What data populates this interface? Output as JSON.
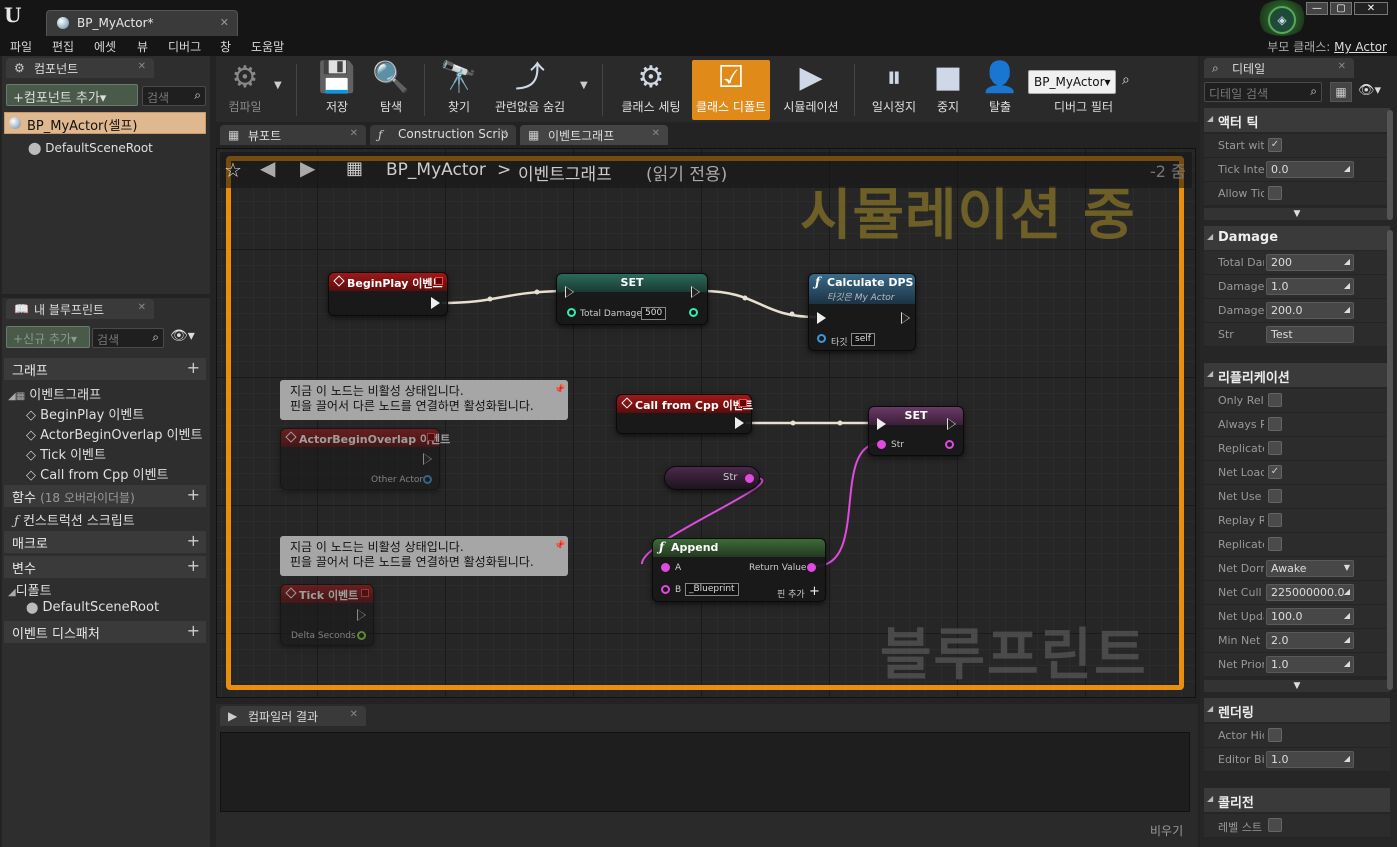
{
  "window": {
    "tab_title": "BP_MyActor*",
    "parent_class_label": "부모 클래스:",
    "parent_class_value": "My Actor"
  },
  "menu": [
    "파일",
    "편집",
    "에셋",
    "뷰",
    "디버그",
    "창",
    "도움말"
  ],
  "components_panel": {
    "tab": "컴포넌트",
    "add_button": "+컴포넌트 추가▾",
    "search_placeholder": "검색",
    "root_item": "BP_MyActor(셀프)",
    "child_item": "DefaultSceneRoot"
  },
  "my_blueprint": {
    "tab": "내 블루프린트",
    "add_new": "+신규 추가▾",
    "search_placeholder": "검색",
    "graphs_label": "그래프",
    "event_graph": "이벤트그래프",
    "events": [
      "BeginPlay 이벤트",
      "ActorBeginOverlap 이벤트",
      "Tick 이벤트",
      "Call from Cpp 이벤트"
    ],
    "functions_label": "함수",
    "functions_sub": "(18 오버라이더블)",
    "construction_script": "컨스트럭션 스크립트",
    "macros_label": "매크로",
    "variables_label": "변수",
    "defaults_label": "디폴트",
    "default_scene_root": "DefaultSceneRoot",
    "dispatchers_label": "이벤트 디스패처"
  },
  "toolbar": {
    "compile": "컴파일",
    "save": "저장",
    "browse": "탐색",
    "find": "찾기",
    "hide_unrelated": "관련없음 숨김",
    "class_settings": "클래스 세팅",
    "class_defaults": "클래스 디폴트",
    "simulation": "시뮬레이션",
    "pause": "일시정지",
    "stop": "중지",
    "eject": "탈출",
    "debug_object": "BP_MyActor▾",
    "debug_filter": "디버그 필터"
  },
  "graph_tabs": [
    "뷰포트",
    "Construction Scrip",
    "이벤트그래프"
  ],
  "graph": {
    "breadcrumb_bp": "BP_MyActor",
    "breadcrumb_sep": ">",
    "breadcrumb_graph": "이벤트그래프",
    "read_only": "(읽기 전용)",
    "zoom": "-2 줌",
    "simulating_watermark": "시뮬레이션 중",
    "blueprint_watermark": "블루프린트",
    "nodes": {
      "beginplay": "BeginPlay 이벤트",
      "set1_title": "SET",
      "set1_pin": "Total Damage",
      "set1_value": "500",
      "calc_title": "Calculate DPS",
      "calc_sub": "타깃은 My Actor",
      "calc_target": "타깃",
      "calc_self": "self",
      "comment1_line1": "지금 이 노드는 비활성 상태입니다.",
      "comment1_line2": "핀을 끌어서 다른 노드를 연결하면 활성화됩니다.",
      "overlap": "ActorBeginOverlap 이벤트",
      "other_actor": "Other Actor",
      "callcpp": "Call from Cpp 이벤트",
      "set2_title": "SET",
      "set2_pin": "Str",
      "str_getter": "Str",
      "append_title": "Append",
      "append_a": "A",
      "append_b": "B",
      "append_b_value": "_Blueprint",
      "append_return": "Return Value",
      "append_add_pin": "핀 추가",
      "comment2_line1": "지금 이 노드는 비활성 상태입니다.",
      "comment2_line2": "핀을 끌어서 다른 노드를 연결하면 활성화됩니다.",
      "tick": "Tick 이벤트",
      "delta": "Delta Seconds"
    }
  },
  "compiler": {
    "tab": "컴파일러 결과",
    "clear": "비우기"
  },
  "details": {
    "tab": "디테일",
    "search_placeholder": "디테일 검색",
    "actor_tick": {
      "label": "액터 틱",
      "rows": [
        {
          "label": "Start with",
          "type": "check",
          "checked": true
        },
        {
          "label": "Tick Inte",
          "type": "num",
          "value": "0.0"
        },
        {
          "label": "Allow Tic",
          "type": "check",
          "checked": false
        }
      ]
    },
    "damage": {
      "label": "Damage",
      "rows": [
        {
          "label": "Total Dar",
          "type": "num",
          "value": "200"
        },
        {
          "label": "Damage",
          "type": "num",
          "value": "1.0"
        },
        {
          "label": "Damage",
          "type": "num",
          "value": "200.0"
        },
        {
          "label": "Str",
          "type": "text",
          "value": "Test"
        }
      ]
    },
    "replication": {
      "label": "리플리케이션",
      "rows": [
        {
          "label": "Only Rele",
          "type": "check",
          "checked": false
        },
        {
          "label": "Always R",
          "type": "check",
          "checked": false
        },
        {
          "label": "Replicate",
          "type": "check",
          "checked": false
        },
        {
          "label": "Net Load",
          "type": "check",
          "checked": true
        },
        {
          "label": "Net Use",
          "type": "check",
          "checked": false
        },
        {
          "label": "Replay R",
          "type": "check",
          "checked": false
        },
        {
          "label": "Replicate",
          "type": "check",
          "checked": false
        },
        {
          "label": "Net Dorm",
          "type": "dropdown",
          "value": "Awake"
        },
        {
          "label": "Net Cull",
          "type": "num",
          "value": "225000000.0"
        },
        {
          "label": "Net Upda",
          "type": "num",
          "value": "100.0"
        },
        {
          "label": "Min Net",
          "type": "num",
          "value": "2.0"
        },
        {
          "label": "Net Prior",
          "type": "num",
          "value": "1.0"
        }
      ]
    },
    "rendering": {
      "label": "렌더링",
      "rows": [
        {
          "label": "Actor Hid",
          "type": "check",
          "checked": false
        },
        {
          "label": "Editor Bil",
          "type": "num",
          "value": "1.0"
        }
      ]
    },
    "collision": {
      "label": "콜리전",
      "rows": [
        {
          "label": "레벨 스트",
          "type": "check",
          "checked": false
        }
      ]
    }
  },
  "colors": {
    "accent_orange": "#e8900e",
    "event_red": "#a01818",
    "exec_white": "#eeeeee",
    "string_pink": "#e04adf",
    "int_teal": "#33eeaa"
  }
}
